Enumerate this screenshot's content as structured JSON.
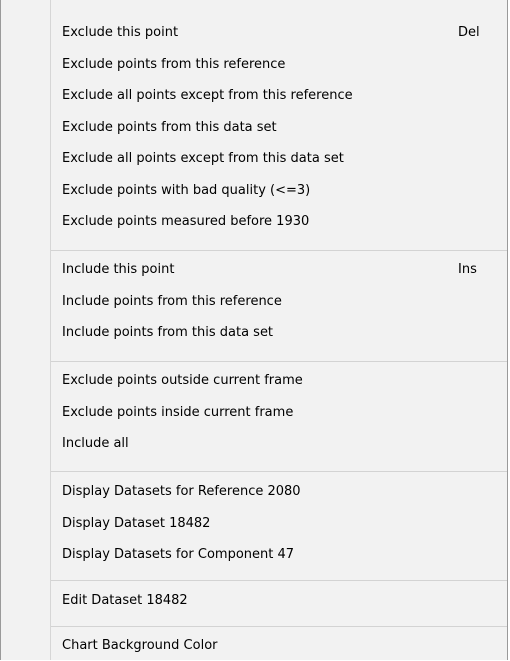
{
  "menu": {
    "groups": [
      {
        "items": [
          {
            "label": "Exclude this point",
            "shortcut": "Del"
          },
          {
            "label": "Exclude points from this reference",
            "shortcut": ""
          },
          {
            "label": "Exclude all points except from this reference",
            "shortcut": ""
          },
          {
            "label": "Exclude points from this data set",
            "shortcut": ""
          },
          {
            "label": "Exclude all points except from this data set",
            "shortcut": ""
          },
          {
            "label": "Exclude points with bad quality (<=3)",
            "shortcut": ""
          },
          {
            "label": "Exclude points measured before 1930",
            "shortcut": ""
          }
        ]
      },
      {
        "items": [
          {
            "label": "Include this point",
            "shortcut": "Ins"
          },
          {
            "label": "Include points from this reference",
            "shortcut": ""
          },
          {
            "label": "Include points from this data set",
            "shortcut": ""
          }
        ]
      },
      {
        "items": [
          {
            "label": "Exclude points outside current frame",
            "shortcut": ""
          },
          {
            "label": "Exclude points inside current frame",
            "shortcut": ""
          },
          {
            "label": "Include all",
            "shortcut": ""
          }
        ]
      },
      {
        "items": [
          {
            "label": "Display Datasets for Reference 2080",
            "shortcut": ""
          },
          {
            "label": "Display Dataset 18482",
            "shortcut": ""
          },
          {
            "label": "Display Datasets for Component 47",
            "shortcut": ""
          }
        ]
      },
      {
        "items": [
          {
            "label": "Edit Dataset 18482",
            "shortcut": ""
          }
        ]
      },
      {
        "items": [
          {
            "label": "Chart Background Color",
            "shortcut": ""
          }
        ]
      }
    ]
  }
}
